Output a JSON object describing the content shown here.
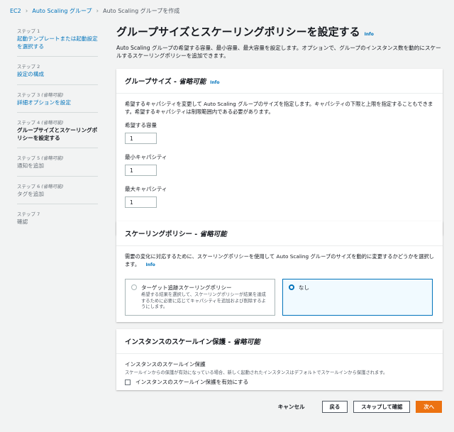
{
  "breadcrumb": {
    "items": [
      "EC2",
      "Auto Scaling グループ"
    ],
    "current": "Auto Scaling グループを作成"
  },
  "sidebar": {
    "steps": [
      {
        "num": "ステップ 1",
        "optional": "",
        "title": "起動テンプレートまたは起動設定を選択する",
        "state": "link"
      },
      {
        "num": "ステップ 2",
        "optional": "",
        "title": "設定の構成",
        "state": "link"
      },
      {
        "num": "ステップ 3",
        "optional": "(省略可能)",
        "title": "詳細オプションを設定",
        "state": "link"
      },
      {
        "num": "ステップ 4",
        "optional": "(省略可能)",
        "title": "グループサイズとスケーリングポリシーを設定する",
        "state": "current"
      },
      {
        "num": "ステップ 5",
        "optional": "(省略可能)",
        "title": "通知を追加",
        "state": "disabled"
      },
      {
        "num": "ステップ 6",
        "optional": "(省略可能)",
        "title": "タグを追加",
        "state": "disabled"
      },
      {
        "num": "ステップ 7",
        "optional": "",
        "title": "確認",
        "state": "disabled"
      }
    ]
  },
  "main": {
    "title": "グループサイズとスケーリングポリシーを設定する",
    "info": "Info",
    "description": "Auto Scaling グループの希望する容量、最小容量、最大容量を設定します。オプションで、グループのインスタンス数を動的にスケールするスケーリングポリシーを追加できます。"
  },
  "group_size": {
    "title": "グループサイズ - ",
    "optional": "省略可能",
    "info": "Info",
    "description": "希望するキャパシティを変更して Auto Scaling グループのサイズを指定します。キャパシティの下限と上限を指定することもできます。希望するキャパシティは制限範囲内である必要があります。",
    "desired_label": "希望する容量",
    "desired_value": "1",
    "min_label": "最小キャパシティ",
    "min_value": "1",
    "max_label": "最大キャパシティ",
    "max_value": "1"
  },
  "scaling_policy": {
    "title": "スケーリングポリシー - ",
    "optional": "省略可能",
    "description": "需要の変化に対応するために、スケーリングポリシーを使用して Auto Scaling グループのサイズを動的に変更するかどうかを選択します。",
    "info": "Info",
    "option_target": {
      "title": "ターゲット追跡スケーリングポリシー",
      "desc": "希望する結果を選択して、スケーリングポリシーが結果を達成するために必要に応じてキャパシティを追加および削除するようにします。"
    },
    "option_none": {
      "title": "なし"
    }
  },
  "scale_in": {
    "title": "インスタンスのスケールイン保護 - ",
    "optional": "省略可能",
    "sub_title": "インスタンスのスケールイン保護",
    "sub_desc": "スケールインからの保護が有効になっている場合、新しく起動されたインスタンスはデフォルトでスケールインから保護されます。",
    "checkbox_label": "インスタンスのスケールイン保護を有効にする"
  },
  "footer": {
    "cancel": "キャンセル",
    "back": "戻る",
    "skip": "スキップして確認",
    "next": "次へ"
  }
}
